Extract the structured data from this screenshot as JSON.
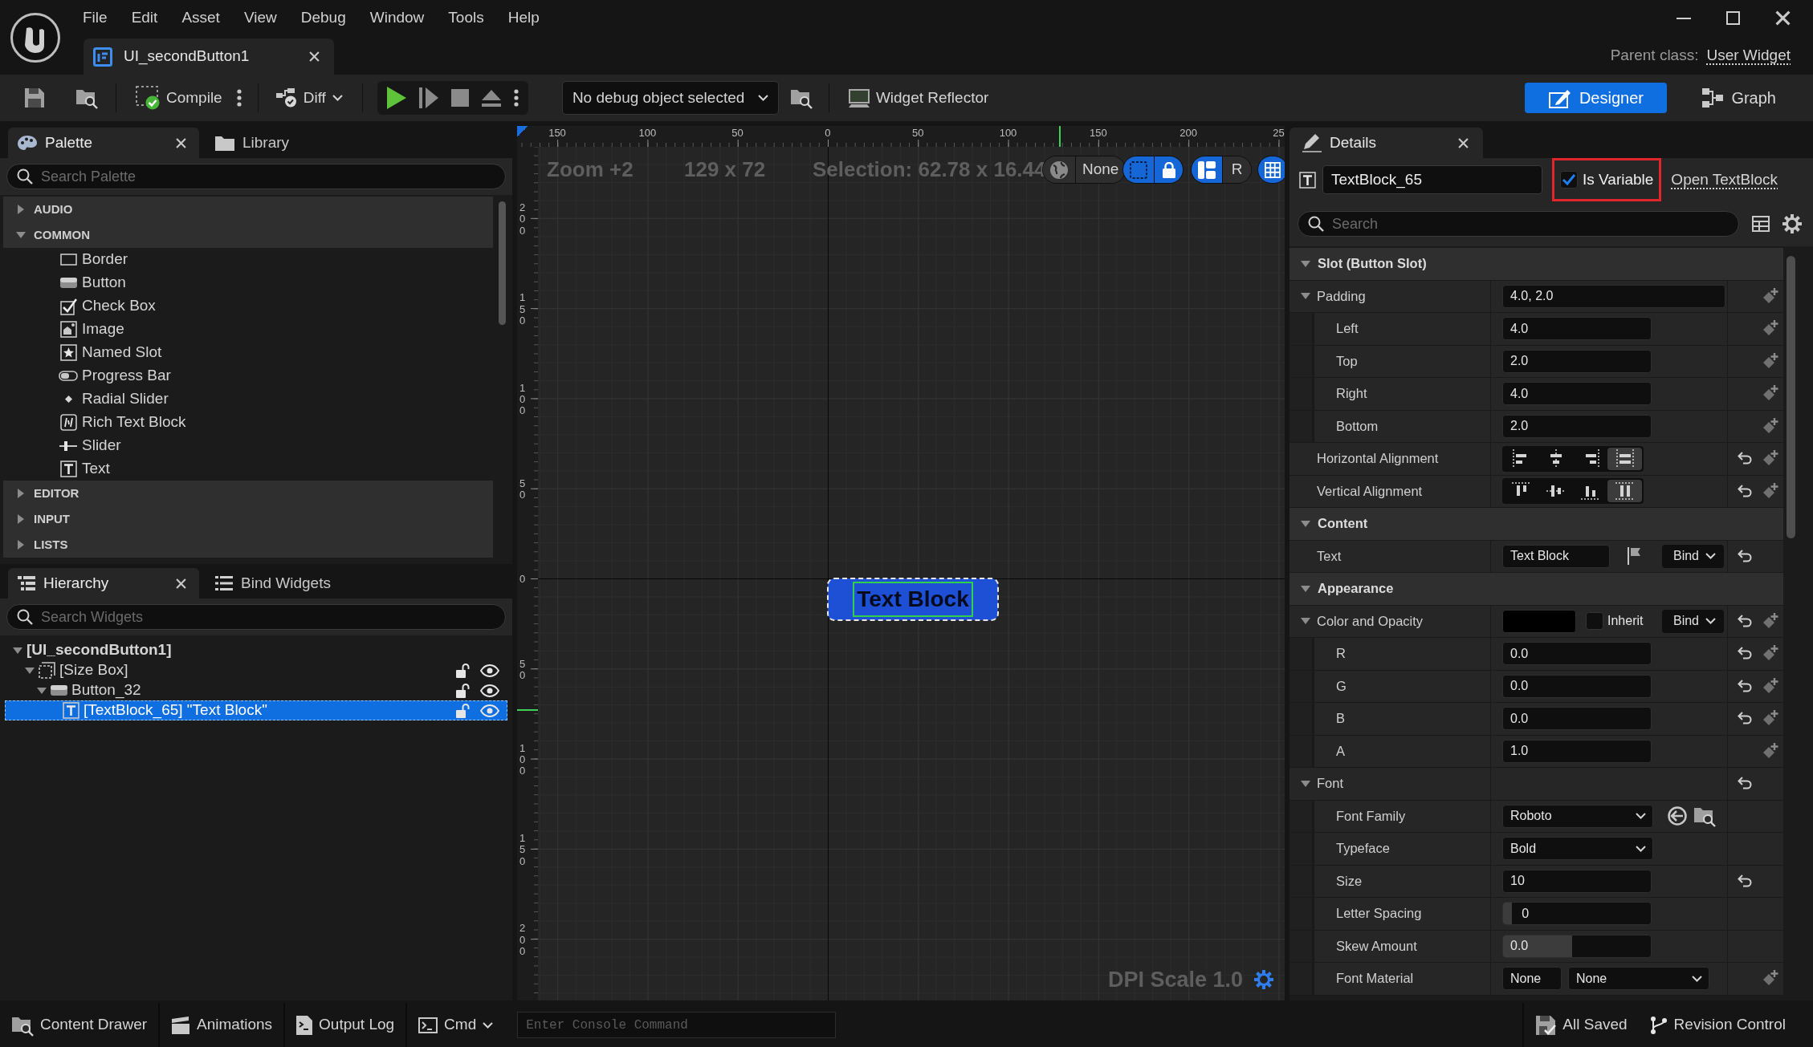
{
  "window": {
    "tab": "UI_secondButton1",
    "parent_class_label": "Parent class:",
    "parent_class": "User Widget"
  },
  "menu": [
    "File",
    "Edit",
    "Asset",
    "View",
    "Debug",
    "Window",
    "Tools",
    "Help"
  ],
  "toolbar": {
    "compile": "Compile",
    "diff": "Diff",
    "debug_object": "No debug object selected",
    "widget_reflector": "Widget Reflector",
    "modes": [
      {
        "label": "Designer",
        "kind": "designer",
        "selected": true
      },
      {
        "label": "Graph",
        "kind": "graph",
        "selected": false
      }
    ]
  },
  "palette": {
    "tabs": [
      {
        "label": "Palette",
        "kind": "palette",
        "selected": true
      },
      {
        "label": "Library",
        "kind": "library",
        "selected": false
      }
    ],
    "search": {
      "placeholder": "Search Palette"
    },
    "categories": [
      {
        "label": "AUDIO",
        "expanded": false
      },
      {
        "label": "COMMON",
        "expanded": true,
        "items": [
          {
            "label": "Border",
            "kind": "border"
          },
          {
            "label": "Button",
            "kind": "button"
          },
          {
            "label": "Check Box",
            "kind": "check-box"
          },
          {
            "label": "Image",
            "kind": "image"
          },
          {
            "label": "Named Slot",
            "kind": "named-slot"
          },
          {
            "label": "Progress Bar",
            "kind": "progress-bar"
          },
          {
            "label": "Radial Slider",
            "kind": "radial-slider"
          },
          {
            "label": "Rich Text Block",
            "kind": "rich-text"
          },
          {
            "label": "Slider",
            "kind": "slider"
          },
          {
            "label": "Text",
            "kind": "text"
          }
        ]
      },
      {
        "label": "EDITOR",
        "expanded": false
      },
      {
        "label": "INPUT",
        "expanded": false
      },
      {
        "label": "LISTS",
        "expanded": false
      }
    ]
  },
  "hierarchy": {
    "tabs": [
      {
        "label": "Hierarchy",
        "kind": "hierarchy",
        "selected": true
      },
      {
        "label": "Bind Widgets",
        "kind": "bind",
        "selected": false
      }
    ],
    "search": {
      "placeholder": "Search Widgets"
    },
    "tree": [
      {
        "label": "[UI_secondButton1]",
        "kind": "root",
        "expanded": true,
        "selected": false,
        "children": [
          {
            "label": "[Size Box]",
            "kind": "size-box",
            "expanded": true,
            "selected": false,
            "locked": false,
            "visible": true,
            "children": [
              {
                "label": "Button_32",
                "kind": "button",
                "expanded": true,
                "selected": false,
                "locked": false,
                "visible": true,
                "children": [
                  {
                    "label": "[TextBlock_65] \"Text Block\"",
                    "kind": "text",
                    "selected": true,
                    "locked": false,
                    "visible": true
                  }
                ]
              }
            ]
          }
        ]
      }
    ]
  },
  "viewport": {
    "top_ruler": [
      "150",
      "100",
      "50",
      "0",
      "50",
      "100",
      "150",
      "200",
      "25"
    ],
    "left_ruler": [
      "200",
      "150",
      "100",
      "50",
      "0",
      "50",
      "100",
      "150",
      "200"
    ],
    "zoom": "Zoom +2",
    "resolution": "129 x 72",
    "selection": "Selection: 62.78 x 16.44",
    "toggle_groups": [
      {
        "segments": [
          {
            "kind": "globe",
            "on": false
          },
          {
            "kind": "label",
            "label": "None",
            "on": false
          }
        ]
      },
      {
        "segments": [
          {
            "kind": "outline",
            "on": true
          },
          {
            "kind": "lock",
            "on": true
          }
        ]
      },
      {
        "segments": [
          {
            "kind": "layout",
            "on": true
          },
          {
            "kind": "label",
            "label": "R",
            "on": false
          }
        ]
      },
      {
        "segments": [
          {
            "kind": "grid",
            "on": true
          }
        ]
      }
    ],
    "widget": {
      "label": "Text Block",
      "selected": true
    },
    "dpi_scale": "DPI Scale 1.0"
  },
  "details": {
    "tab": "Details",
    "name": "TextBlock_65",
    "is_variable": {
      "label": "Is Variable",
      "checked": true,
      "highlighted": true
    },
    "open_link": "Open TextBlock",
    "search": {
      "placeholder": "Search"
    },
    "sections": [
      {
        "label": "Slot (Button Slot)",
        "expanded": true,
        "rows": [
          {
            "label": "Padding",
            "kind": "vector",
            "value": "4.0, 2.0",
            "expanded": true,
            "reset": false,
            "keyframe": true,
            "children": [
              {
                "label": "Left",
                "kind": "number",
                "value": "4.0",
                "reset": false,
                "keyframe": true
              },
              {
                "label": "Top",
                "kind": "number",
                "value": "2.0",
                "reset": false,
                "keyframe": true
              },
              {
                "label": "Right",
                "kind": "number",
                "value": "4.0",
                "reset": false,
                "keyframe": true
              },
              {
                "label": "Bottom",
                "kind": "number",
                "value": "2.0",
                "reset": false,
                "keyframe": true
              }
            ]
          },
          {
            "label": "Horizontal Alignment",
            "kind": "align",
            "options": [
              {
                "kind": "left",
                "selected": false
              },
              {
                "kind": "center",
                "selected": false
              },
              {
                "kind": "right",
                "selected": false
              },
              {
                "kind": "fill",
                "selected": true
              }
            ],
            "reset": true,
            "keyframe": true
          },
          {
            "label": "Vertical Alignment",
            "kind": "align",
            "options": [
              {
                "kind": "top",
                "selected": false
              },
              {
                "kind": "middle",
                "selected": false
              },
              {
                "kind": "bottom",
                "selected": false
              },
              {
                "kind": "fill-vertical",
                "selected": true
              }
            ],
            "reset": true,
            "keyframe": true
          }
        ]
      },
      {
        "label": "Content",
        "expanded": true,
        "rows": [
          {
            "label": "Text",
            "kind": "text",
            "value": "Text Block",
            "bind": "Bind",
            "reset": true,
            "keyframe": false
          }
        ]
      },
      {
        "label": "Appearance",
        "expanded": true,
        "rows": [
          {
            "label": "Color and Opacity",
            "kind": "color",
            "color": "#000000",
            "inherit": {
              "label": "Inherit",
              "checked": false
            },
            "bind": "Bind",
            "expanded": true,
            "reset": true,
            "keyframe": true,
            "children": [
              {
                "label": "R",
                "kind": "number",
                "value": "0.0",
                "reset": true,
                "keyframe": true
              },
              {
                "label": "G",
                "kind": "number",
                "value": "0.0",
                "reset": true,
                "keyframe": true
              },
              {
                "label": "B",
                "kind": "number",
                "value": "0.0",
                "reset": true,
                "keyframe": true
              },
              {
                "label": "A",
                "kind": "number",
                "value": "1.0",
                "reset": false,
                "keyframe": true
              }
            ]
          },
          {
            "label": "Font",
            "kind": "group",
            "expanded": true,
            "reset": true,
            "keyframe": false,
            "children": [
              {
                "label": "Font Family",
                "kind": "asset",
                "value": "Roboto",
                "reset": false,
                "keyframe": false
              },
              {
                "label": "Typeface",
                "kind": "dropdown",
                "value": "Bold",
                "reset": false,
                "keyframe": false
              },
              {
                "label": "Size",
                "kind": "number",
                "value": "10",
                "reset": true,
                "keyframe": false
              },
              {
                "label": "Letter Spacing",
                "kind": "spin",
                "value": "0",
                "level": 0.06,
                "reset": false,
                "keyframe": false
              },
              {
                "label": "Skew Amount",
                "kind": "spin",
                "value": "0.0",
                "level": 0.47,
                "reset": false,
                "keyframe": false
              },
              {
                "label": "Font Material",
                "kind": "material",
                "value": "None",
                "dropdown": "None",
                "reset": false,
                "keyframe": true
              }
            ]
          }
        ]
      }
    ]
  },
  "status_bar": {
    "left": [
      {
        "label": "Content Drawer",
        "kind": "drawer"
      },
      {
        "label": "Animations",
        "kind": "animations"
      },
      {
        "label": "Output Log",
        "kind": "log"
      },
      {
        "label": "Cmd",
        "kind": "cmd"
      }
    ],
    "console": {
      "placeholder": "Enter Console Command"
    },
    "right": [
      {
        "label": "All Saved",
        "kind": "saved"
      },
      {
        "label": "Revision Control",
        "kind": "revision"
      }
    ]
  }
}
